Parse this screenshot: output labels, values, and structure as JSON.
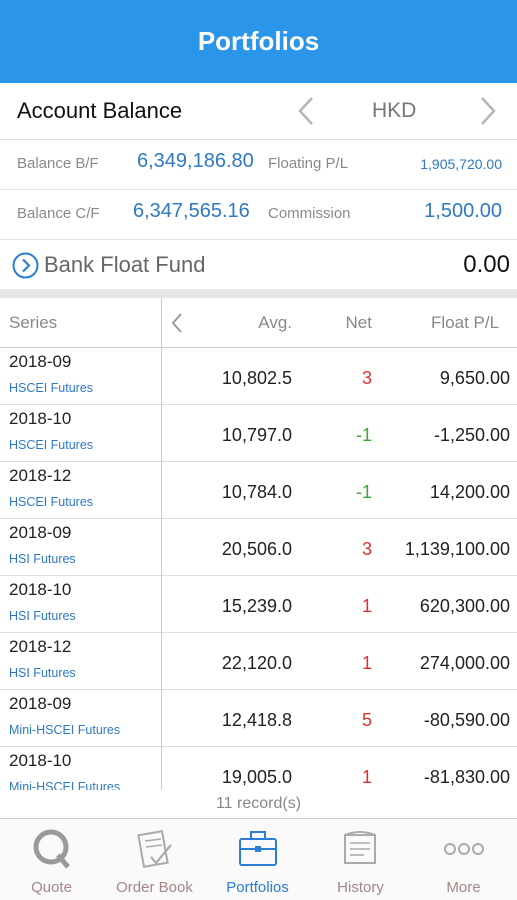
{
  "header": {
    "title": "Portfolios"
  },
  "account": {
    "label": "Account Balance",
    "currency": "HKD"
  },
  "balances": [
    {
      "k1": "Balance B/F",
      "v1": "6,349,186.80",
      "k2": "Floating P/L",
      "v2": "1,905,720.00"
    },
    {
      "k1": "Balance C/F",
      "v1": "6,347,565.16",
      "k2": "Commission",
      "v2": "1,500.00"
    }
  ],
  "bank": {
    "label": "Bank Float Fund",
    "value": "0.00"
  },
  "table": {
    "headers": {
      "series": "Series",
      "avg": "Avg.",
      "net": "Net",
      "float": "Float P/L"
    },
    "rows": [
      {
        "series": "2018-09",
        "product": "HSCEI Futures",
        "avg": "10,802.5",
        "net": "3",
        "float": "9,650.00"
      },
      {
        "series": "2018-10",
        "product": "HSCEI Futures",
        "avg": "10,797.0",
        "net": "-1",
        "float": "-1,250.00"
      },
      {
        "series": "2018-12",
        "product": "HSCEI Futures",
        "avg": "10,784.0",
        "net": "-1",
        "float": "14,200.00"
      },
      {
        "series": "2018-09",
        "product": "HSI Futures",
        "avg": "20,506.0",
        "net": "3",
        "float": "1,139,100.00"
      },
      {
        "series": "2018-10",
        "product": "HSI Futures",
        "avg": "15,239.0",
        "net": "1",
        "float": "620,300.00"
      },
      {
        "series": "2018-12",
        "product": "HSI Futures",
        "avg": "22,120.0",
        "net": "1",
        "float": "274,000.00"
      },
      {
        "series": "2018-09",
        "product": "Mini-HSCEI Futures",
        "avg": "12,418.8",
        "net": "5",
        "float": "-80,590.00"
      },
      {
        "series": "2018-10",
        "product": "Mini-HSCEI Futures",
        "avg": "19,005.0",
        "net": "1",
        "float": "-81,830.00"
      }
    ],
    "record_count": "11 record(s)"
  },
  "tabs": [
    {
      "label": "Quote",
      "icon": "quote-icon"
    },
    {
      "label": "Order Book",
      "icon": "order-book-icon"
    },
    {
      "label": "Portfolios",
      "icon": "briefcase-icon",
      "active": true
    },
    {
      "label": "History",
      "icon": "history-icon"
    },
    {
      "label": "More",
      "icon": "more-icon"
    }
  ],
  "colors": {
    "accent": "#2b95ea",
    "link": "#2d79c7",
    "positive": "#e03030",
    "negative": "#3aa63a"
  }
}
